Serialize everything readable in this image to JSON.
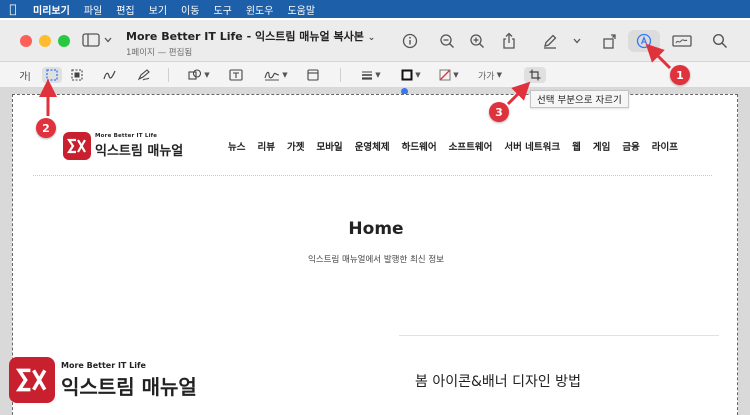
{
  "menubar": {
    "app": "미리보기",
    "items": [
      "파일",
      "편집",
      "보기",
      "이동",
      "도구",
      "윈도우",
      "도움말"
    ]
  },
  "window": {
    "title": "More Better IT Life - 익스트림 매뉴얼 복사본",
    "subtitle": "1페이지 — 편집됨"
  },
  "toolbar": {
    "icons": [
      "info-icon",
      "zoom-out-icon",
      "zoom-in-icon",
      "share-icon",
      "highlight-pen-icon",
      "rotate-icon",
      "markup-icon",
      "signature-box-icon",
      "search-icon"
    ]
  },
  "markup": {
    "text_select_label": "가|",
    "font_label": "가가"
  },
  "tooltip": "선택 부분으로 자르기",
  "callouts": [
    "1",
    "2",
    "3"
  ],
  "site": {
    "logo_tagline": "More Better IT Life",
    "logo_name": "익스트림 매뉴얼",
    "nav": [
      "뉴스",
      "리뷰",
      "가젯",
      "모바일",
      "운영체제",
      "하드웨어",
      "소프트웨어",
      "서버 네트워크",
      "웹",
      "게임",
      "금융",
      "라이프"
    ],
    "hero_title": "Home",
    "hero_subtitle": "익스트림 매뉴얼에서 발행한 최신 정보",
    "post_title": "봄 아이콘&배너 디자인 방법"
  },
  "colors": {
    "menubar": "#1d5fa8",
    "brand_red": "#c8202f",
    "callout_red": "#e0323c",
    "accent_blue": "#3478f6"
  }
}
